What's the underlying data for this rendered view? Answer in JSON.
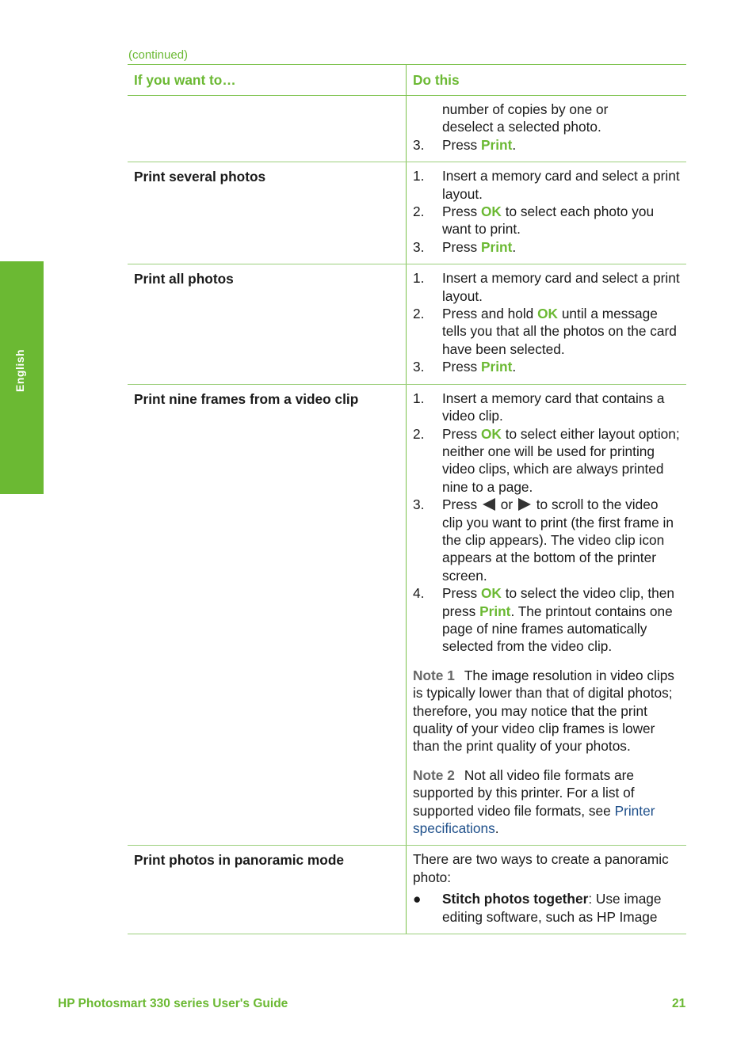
{
  "side_tab": {
    "label": "English",
    "color": "#6bb933"
  },
  "continued_label": "(continued)",
  "table": {
    "headers": {
      "col1": "If you want to…",
      "col2": "Do this"
    },
    "rows": [
      {
        "task": "",
        "lines": {
          "cont_a": "number of copies by one or",
          "cont_b": "deselect a selected photo.",
          "s3_num": "3.",
          "s3_pre": "Press ",
          "s3_hl": "Print",
          "s3_post": "."
        }
      },
      {
        "task": "Print several photos",
        "lines": {
          "s1_num": "1.",
          "s1": "Insert a memory card and select a print layout.",
          "s2_num": "2.",
          "s2_pre": "Press ",
          "s2_hl": "OK",
          "s2_post": " to select each photo you want to print.",
          "s3_num": "3.",
          "s3_pre": "Press ",
          "s3_hl": "Print",
          "s3_post": "."
        }
      },
      {
        "task": "Print all photos",
        "lines": {
          "s1_num": "1.",
          "s1": "Insert a memory card and select a print layout.",
          "s2_num": "2.",
          "s2_pre": "Press and hold ",
          "s2_hl": "OK",
          "s2_post": " until a message tells you that all the photos on the card have been selected.",
          "s3_num": "3.",
          "s3_pre": "Press ",
          "s3_hl": "Print",
          "s3_post": "."
        }
      },
      {
        "task": "Print nine frames from a video clip",
        "lines": {
          "s1_num": "1.",
          "s1": "Insert a memory card that contains a video clip.",
          "s2_num": "2.",
          "s2_pre": "Press ",
          "s2_hl": "OK",
          "s2_post": " to select either layout option; neither one will be used for printing video clips, which are always printed nine to a page.",
          "s3_num": "3.",
          "s3_pre": "Press ",
          "s3_mid": " or ",
          "s3_post": " to scroll to the video clip you want to print (the first frame in the clip appears). The video clip icon appears at the bottom of the printer screen.",
          "s4_num": "4.",
          "s4_pre": "Press ",
          "s4_hl": "OK",
          "s4_mid": " to select the video clip, then press ",
          "s4_hl2": "Print",
          "s4_post": ". The printout contains one page of nine frames automatically selected from the video clip."
        },
        "notes": [
          {
            "label": "Note 1",
            "text": "The image resolution in video clips is typically lower than that of digital photos; therefore, you may notice that the print quality of your video clip frames is lower than the print quality of your photos."
          },
          {
            "label": "Note 2",
            "text": "Not all video file formats are supported by this printer. For a list of supported video file formats, see ",
            "link": "Printer specifications",
            "post": "."
          }
        ]
      },
      {
        "task": "Print photos in panoramic mode",
        "lines": {
          "intro": "There are two ways to create a panoramic photo:",
          "bullet": "●",
          "b1_bold": "Stitch photos together",
          "b1_text": ": Use image editing software, such as HP Image"
        }
      }
    ]
  },
  "icons": {
    "left_arrow": "left-arrow-button",
    "right_arrow": "right-arrow-button"
  },
  "colors": {
    "accent": "#6bb933",
    "link": "#1e4f8a",
    "note_label": "#666666"
  },
  "footer": {
    "title": "HP Photosmart 330 series User's Guide",
    "page_number": "21"
  }
}
